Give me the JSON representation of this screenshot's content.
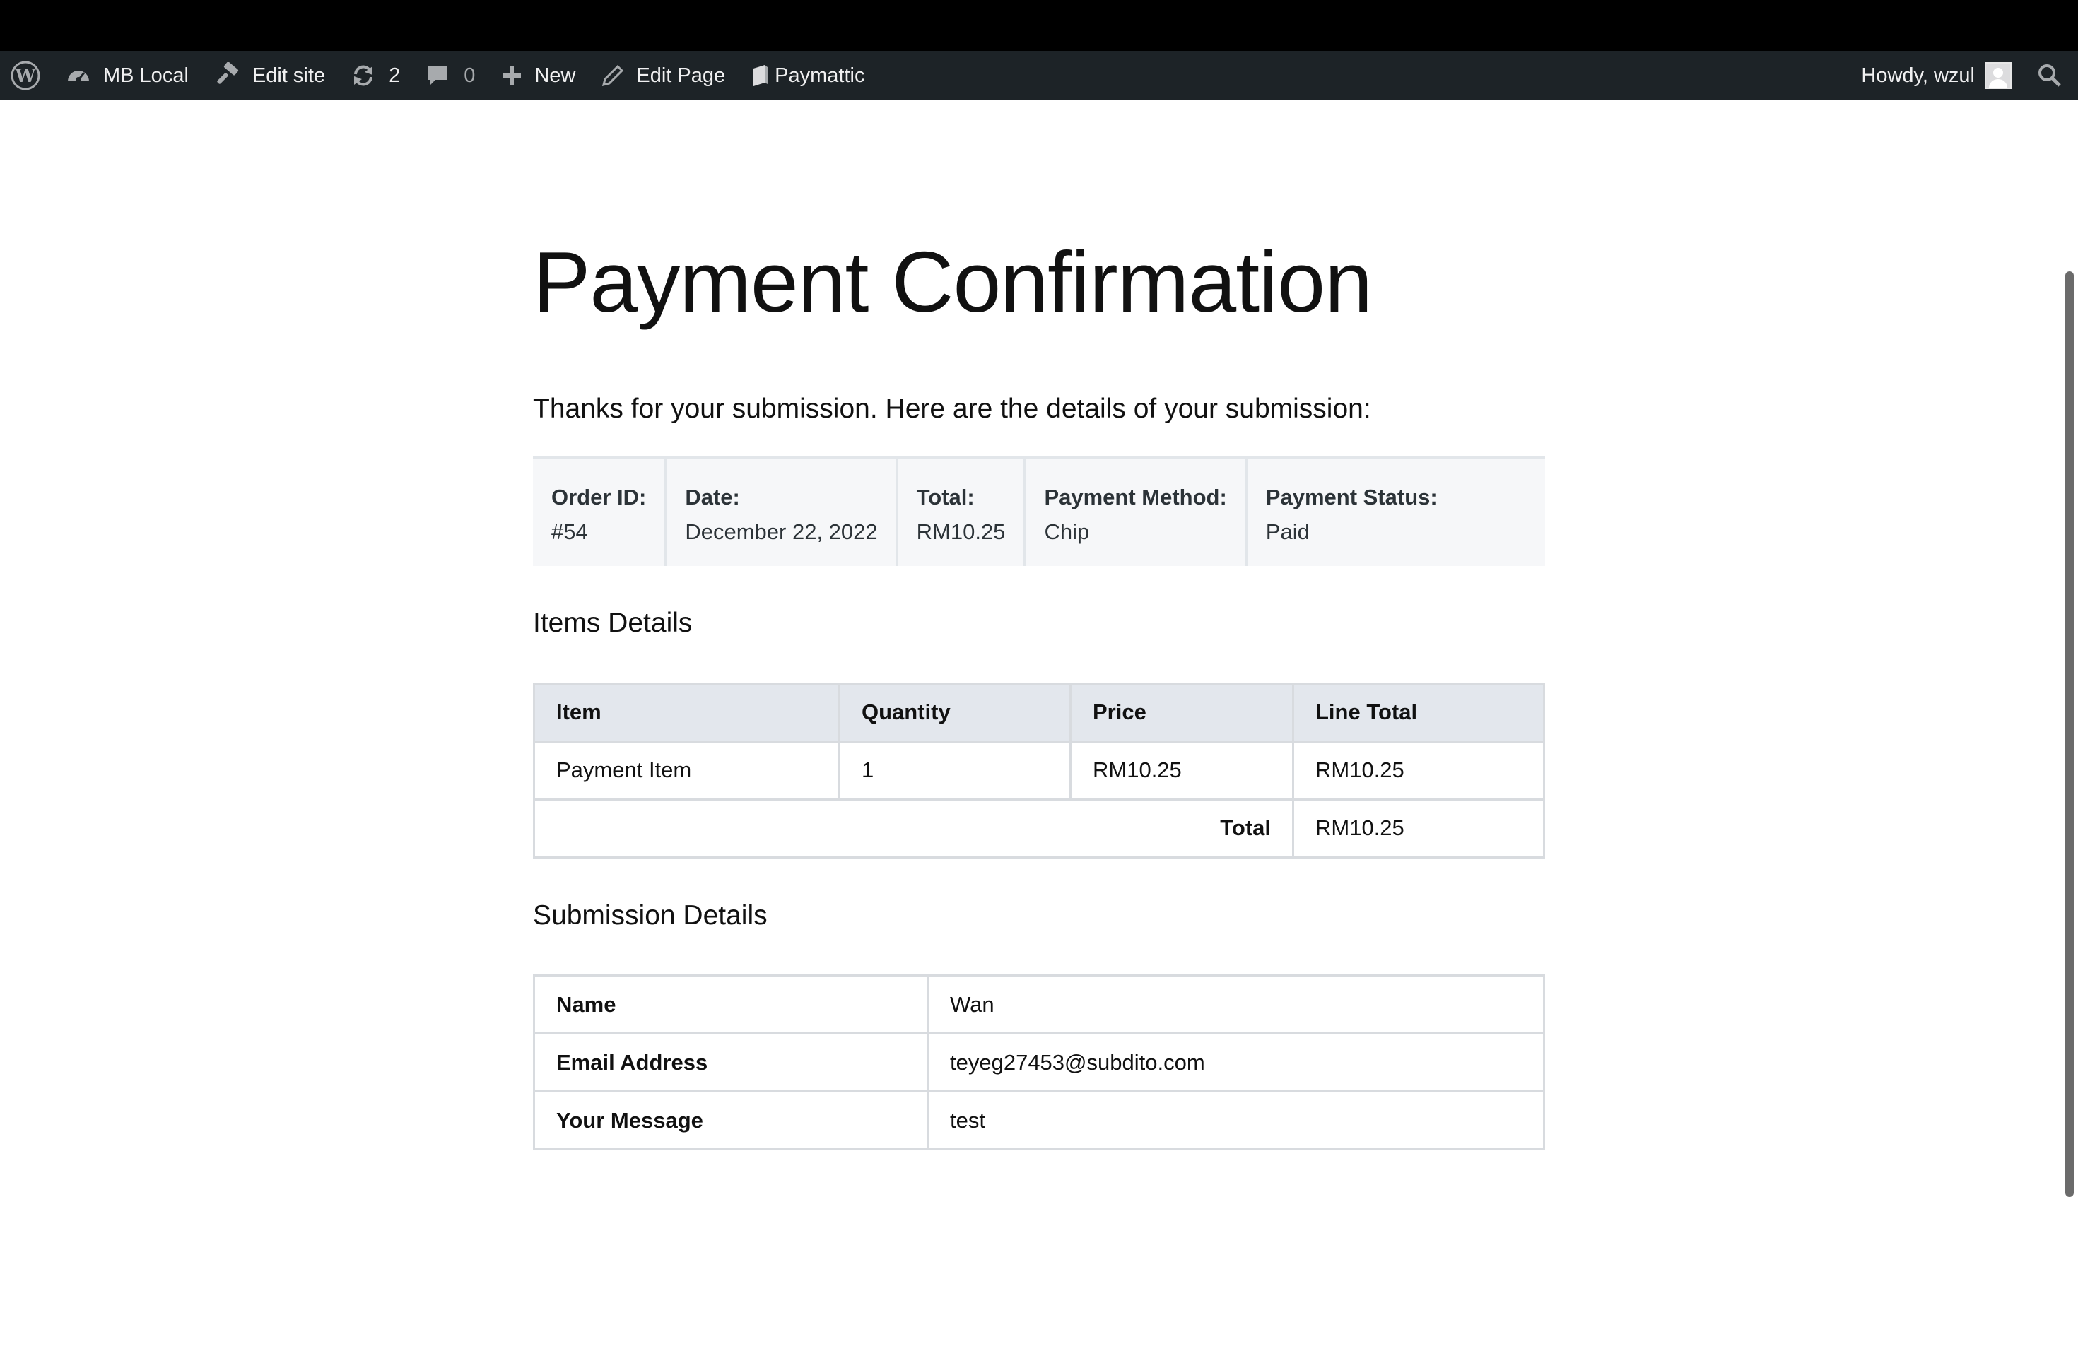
{
  "admin_bar": {
    "site_name": "MB Local",
    "edit_site": "Edit site",
    "updates_count": "2",
    "comments_count": "0",
    "new_label": "New",
    "edit_page": "Edit Page",
    "plugin": "Paymattic",
    "howdy": "Howdy, wzul"
  },
  "page": {
    "title": "Payment Confirmation",
    "intro": "Thanks for your submission. Here are the details of your submission:"
  },
  "summary": [
    {
      "label": "Order ID:",
      "value": "#54"
    },
    {
      "label": "Date:",
      "value": "December 22, 2022"
    },
    {
      "label": "Total:",
      "value": "RM10.25"
    },
    {
      "label": "Payment Method:",
      "value": "Chip"
    },
    {
      "label": "Payment Status:",
      "value": "Paid"
    }
  ],
  "items_section": {
    "title": "Items Details",
    "headers": [
      "Item",
      "Quantity",
      "Price",
      "Line Total"
    ],
    "rows": [
      {
        "item": "Payment Item",
        "quantity": "1",
        "price": "RM10.25",
        "line_total": "RM10.25"
      }
    ],
    "total_label": "Total",
    "total_value": "RM10.25"
  },
  "submission_section": {
    "title": "Submission Details",
    "rows": [
      {
        "label": "Name",
        "value": "Wan"
      },
      {
        "label": "Email Address",
        "value": "teyeg27453@subdito.com"
      },
      {
        "label": "Your Message",
        "value": "test"
      }
    ]
  },
  "colors": {
    "admin_bar_bg": "#1d2327",
    "admin_bar_text": "#f0f0f1",
    "summary_bg": "#f6f7f9",
    "table_header_bg": "#e3e7ed",
    "table_border": "#d8dbdf"
  }
}
